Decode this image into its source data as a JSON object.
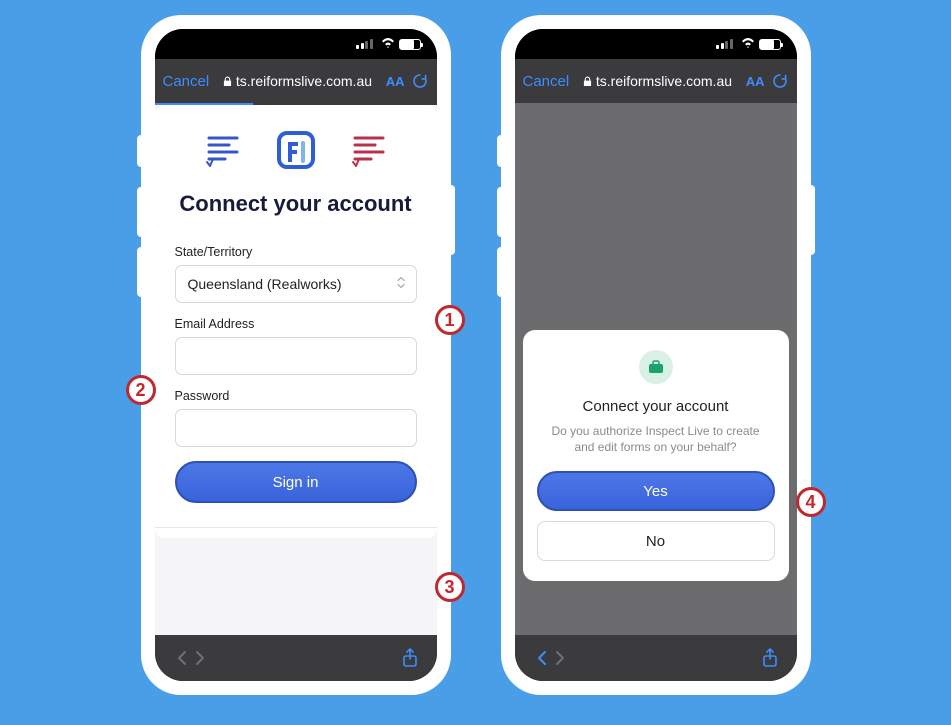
{
  "badges": {
    "b1": "1",
    "b2": "2",
    "b3": "3",
    "b4": "4"
  },
  "safari": {
    "cancel": "Cancel",
    "url": "ts.reiformslive.com.au",
    "aa": "AA"
  },
  "left": {
    "headline": "Connect your account",
    "state_label": "State/Territory",
    "state_value": "Queensland (Realworks)",
    "email_label": "Email Address",
    "password_label": "Password",
    "signin": "Sign in"
  },
  "right": {
    "modal_title": "Connect your account",
    "modal_text": "Do you authorize Inspect Live to create and edit forms on your behalf?",
    "yes": "Yes",
    "no": "No"
  }
}
